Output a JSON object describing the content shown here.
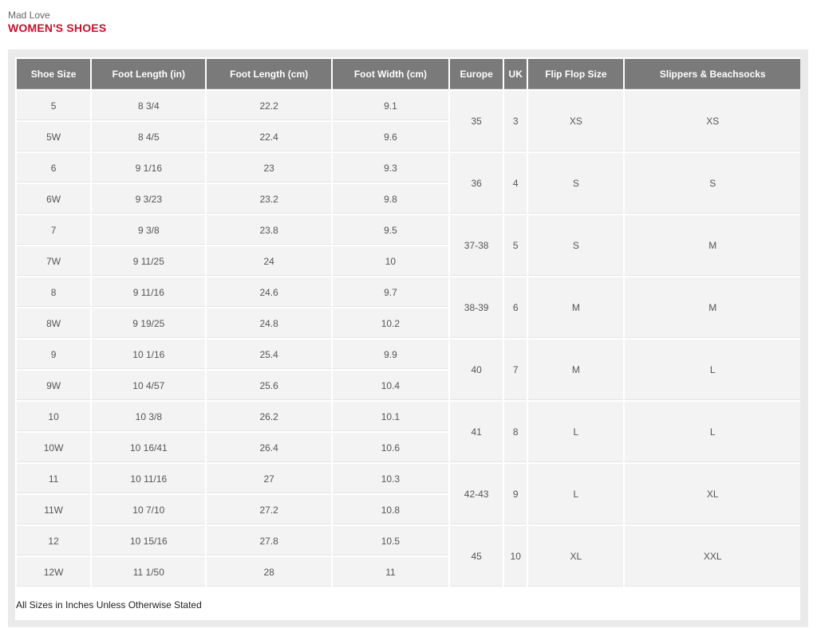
{
  "brand": "Mad Love",
  "section_title": "WOMEN'S SHOES",
  "table": {
    "headers": [
      "Shoe Size",
      "Foot Length (in)",
      "Foot Length (cm)",
      "Foot Width (cm)",
      "Europe",
      "UK",
      "Flip Flop Size",
      "Slippers & Beachsocks"
    ],
    "rows": [
      [
        "5",
        "8 3/4",
        "22.2",
        "9.1"
      ],
      [
        "5W",
        "8 4/5",
        "22.4",
        "9.6"
      ],
      [
        "6",
        "9 1/16",
        "23",
        "9.3"
      ],
      [
        "6W",
        "9 3/23",
        "23.2",
        "9.8"
      ],
      [
        "7",
        "9 3/8",
        "23.8",
        "9.5"
      ],
      [
        "7W",
        "9 11/25",
        "24",
        "10"
      ],
      [
        "8",
        "9 11/16",
        "24.6",
        "9.7"
      ],
      [
        "8W",
        "9 19/25",
        "24.8",
        "10.2"
      ],
      [
        "9",
        "10 1/16",
        "25.4",
        "9.9"
      ],
      [
        "9W",
        "10 4/57",
        "25.6",
        "10.4"
      ],
      [
        "10",
        "10 3/8",
        "26.2",
        "10.1"
      ],
      [
        "10W",
        "10 16/41",
        "26.4",
        "10.6"
      ],
      [
        "11",
        "10 11/16",
        "27",
        "10.3"
      ],
      [
        "11W",
        "10 7/10",
        "27.2",
        "10.8"
      ],
      [
        "12",
        "10 15/16",
        "27.8",
        "10.5"
      ],
      [
        "12W",
        "11 1/50",
        "28",
        "11"
      ]
    ],
    "groups": [
      [
        "35",
        "3",
        "XS",
        "XS"
      ],
      [
        "36",
        "4",
        "S",
        "S"
      ],
      [
        "37-38",
        "5",
        "S",
        "M"
      ],
      [
        "38-39",
        "6",
        "M",
        "M"
      ],
      [
        "40",
        "7",
        "M",
        "L"
      ],
      [
        "41",
        "8",
        "L",
        "L"
      ],
      [
        "42-43",
        "9",
        "L",
        "XL"
      ],
      [
        "45",
        "10",
        "XL",
        "XXL"
      ]
    ]
  },
  "footnote": "All Sizes in Inches Unless Otherwise Stated",
  "colors": {
    "title": "#c8102e",
    "header_bg": "#7a7a7a",
    "cell_bg": "#f3f3f3",
    "panel_bg": "#eaeaea"
  }
}
